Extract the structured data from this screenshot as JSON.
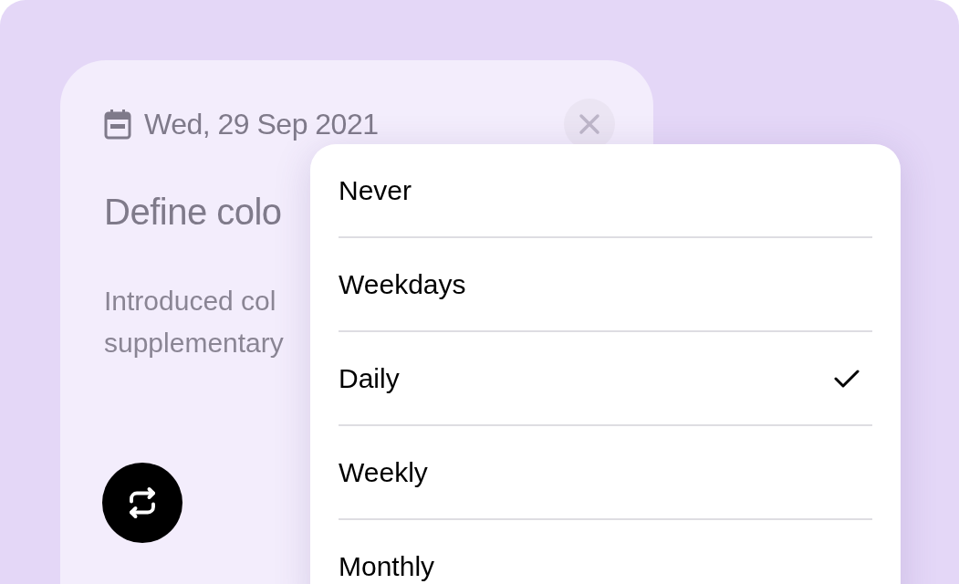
{
  "card": {
    "date": "Wed, 29 Sep 2021",
    "title": "Define colo",
    "description_lines": [
      "Introduced col",
      "supplementary"
    ]
  },
  "menu": {
    "options": [
      {
        "label": "Never",
        "selected": false
      },
      {
        "label": "Weekdays",
        "selected": false
      },
      {
        "label": "Daily",
        "selected": true
      },
      {
        "label": "Weekly",
        "selected": false
      },
      {
        "label": "Monthly",
        "selected": false
      }
    ]
  }
}
